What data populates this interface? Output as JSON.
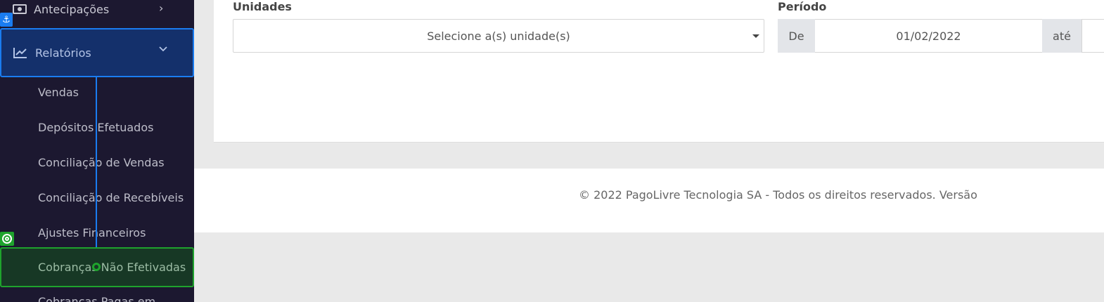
{
  "sidebar": {
    "antecipacoes": {
      "label": "Antecipações",
      "icon": "money-bill-icon"
    },
    "relatorios": {
      "label": "Relatórios",
      "icon": "chart-line-icon",
      "expanded": true
    },
    "submenu": [
      {
        "label": "Vendas"
      },
      {
        "label": "Depósitos Efetuados"
      },
      {
        "label": "Conciliação de Vendas"
      },
      {
        "label": "Conciliação de Recebíveis"
      },
      {
        "label": "Ajustes Financeiros"
      },
      {
        "label": "Cobranças Não Efetivadas"
      },
      {
        "label": "Cobranças Pagas em"
      }
    ]
  },
  "filters": {
    "unidades_label": "Unidades",
    "unidades_placeholder": "Selecione a(s) unidade(s)",
    "periodo_label": "Período",
    "de_label": "De",
    "de_value": "01/02/2022",
    "ate_label": "até"
  },
  "footer": {
    "text": "© 2022 PagoLivre Tecnologia SA - Todos os direitos reservados. Versão"
  },
  "colors": {
    "sidebar_bg": "#1c1830",
    "active_blue": "#1a7cf0",
    "active_green": "#1fa32d",
    "page_bg": "#e9e9e9"
  }
}
